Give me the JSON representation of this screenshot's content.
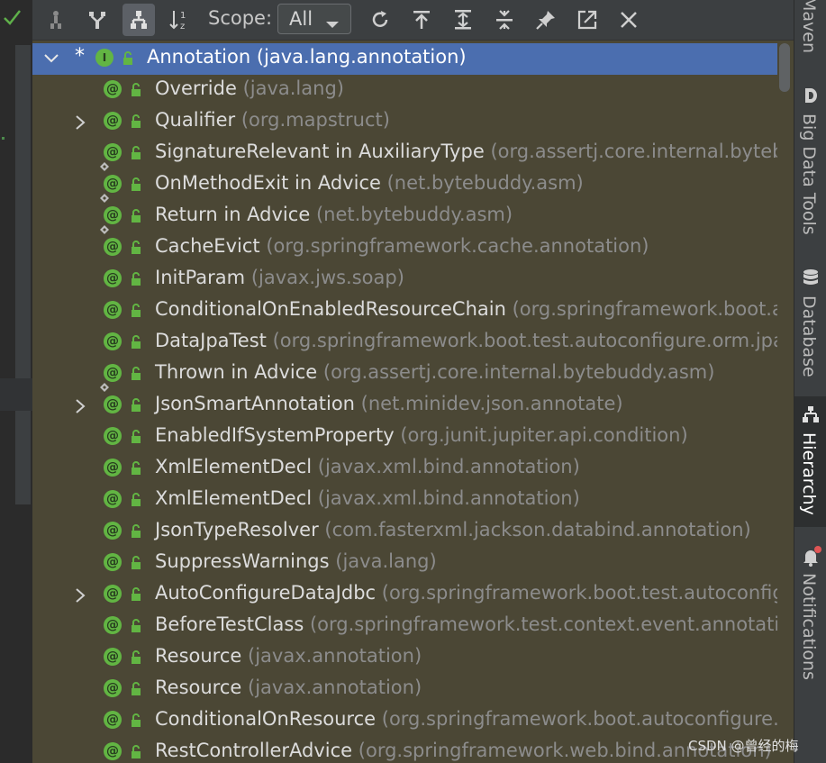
{
  "toolbar": {
    "scope_label": "Scope:",
    "scope_value": "All",
    "buttons": [
      {
        "icon": "supertypes-hierarchy-icon"
      },
      {
        "icon": "subtypes-hierarchy-icon"
      },
      {
        "icon": "class-hierarchy-icon"
      },
      {
        "icon": "sort-alphabetically-icon"
      },
      {
        "icon": "refresh-icon"
      },
      {
        "icon": "export-icon"
      },
      {
        "icon": "expand-all-icon"
      },
      {
        "icon": "collapse-all-icon"
      },
      {
        "icon": "pin-icon"
      },
      {
        "icon": "open-in-window-icon"
      },
      {
        "icon": "close-icon"
      }
    ]
  },
  "tree": {
    "root": {
      "marker": "*",
      "name": "Annotation",
      "pkg": "(java.lang.annotation)"
    },
    "items": [
      {
        "name": "Override",
        "pkg": "(java.lang)",
        "expandable": false,
        "nested": false
      },
      {
        "name": "Qualifier",
        "pkg": "(org.mapstruct)",
        "expandable": true,
        "nested": false
      },
      {
        "name": "SignatureRelevant in AuxiliaryType",
        "pkg": "(org.assertj.core.internal.bytebuddy",
        "expandable": false,
        "nested": true
      },
      {
        "name": "OnMethodExit in Advice",
        "pkg": "(net.bytebuddy.asm)",
        "expandable": false,
        "nested": true
      },
      {
        "name": "Return in Advice",
        "pkg": "(net.bytebuddy.asm)",
        "expandable": false,
        "nested": true
      },
      {
        "name": "CacheEvict",
        "pkg": "(org.springframework.cache.annotation)",
        "expandable": false,
        "nested": false
      },
      {
        "name": "InitParam",
        "pkg": "(javax.jws.soap)",
        "expandable": false,
        "nested": false
      },
      {
        "name": "ConditionalOnEnabledResourceChain",
        "pkg": "(org.springframework.boot.autoc",
        "expandable": false,
        "nested": false
      },
      {
        "name": "DataJpaTest",
        "pkg": "(org.springframework.boot.test.autoconfigure.orm.jpa)",
        "expandable": false,
        "nested": false
      },
      {
        "name": "Thrown in Advice",
        "pkg": "(org.assertj.core.internal.bytebuddy.asm)",
        "expandable": false,
        "nested": true
      },
      {
        "name": "JsonSmartAnnotation",
        "pkg": "(net.minidev.json.annotate)",
        "expandable": true,
        "nested": false
      },
      {
        "name": "EnabledIfSystemProperty",
        "pkg": "(org.junit.jupiter.api.condition)",
        "expandable": false,
        "nested": false
      },
      {
        "name": "XmlElementDecl",
        "pkg": "(javax.xml.bind.annotation)",
        "expandable": false,
        "nested": false
      },
      {
        "name": "XmlElementDecl",
        "pkg": "(javax.xml.bind.annotation)",
        "expandable": false,
        "nested": false
      },
      {
        "name": "JsonTypeResolver",
        "pkg": "(com.fasterxml.jackson.databind.annotation)",
        "expandable": false,
        "nested": false
      },
      {
        "name": "SuppressWarnings",
        "pkg": "(java.lang)",
        "expandable": false,
        "nested": false
      },
      {
        "name": "AutoConfigureDataJdbc",
        "pkg": "(org.springframework.boot.test.autoconfigure.",
        "expandable": true,
        "nested": false
      },
      {
        "name": "BeforeTestClass",
        "pkg": "(org.springframework.test.context.event.annotation)",
        "expandable": false,
        "nested": false
      },
      {
        "name": "Resource",
        "pkg": "(javax.annotation)",
        "expandable": false,
        "nested": false
      },
      {
        "name": "Resource",
        "pkg": "(javax.annotation)",
        "expandable": false,
        "nested": false
      },
      {
        "name": "ConditionalOnResource",
        "pkg": "(org.springframework.boot.autoconfigure.cond",
        "expandable": false,
        "nested": false
      },
      {
        "name": "RestControllerAdvice",
        "pkg": "(org.springframework.web.bind.annotation)",
        "expandable": false,
        "nested": false
      }
    ]
  },
  "rightbar": {
    "items": [
      {
        "label": "Maven",
        "icon": "maven-icon",
        "active": false
      },
      {
        "label": "Big Data Tools",
        "icon": "big-data-tools-icon",
        "active": false
      },
      {
        "label": "Database",
        "icon": "database-icon",
        "active": false
      },
      {
        "label": "Hierarchy",
        "icon": "hierarchy-icon",
        "active": true
      },
      {
        "label": "Notifications",
        "icon": "notifications-icon",
        "active": false
      }
    ]
  },
  "watermark": "CSDN @曾经的梅",
  "colors": {
    "background": "#4b4735",
    "selection": "#4b6eaf",
    "annotation_badge": "#62b543",
    "text": "#dcdcdc",
    "package_text": "#8c8c8c"
  }
}
